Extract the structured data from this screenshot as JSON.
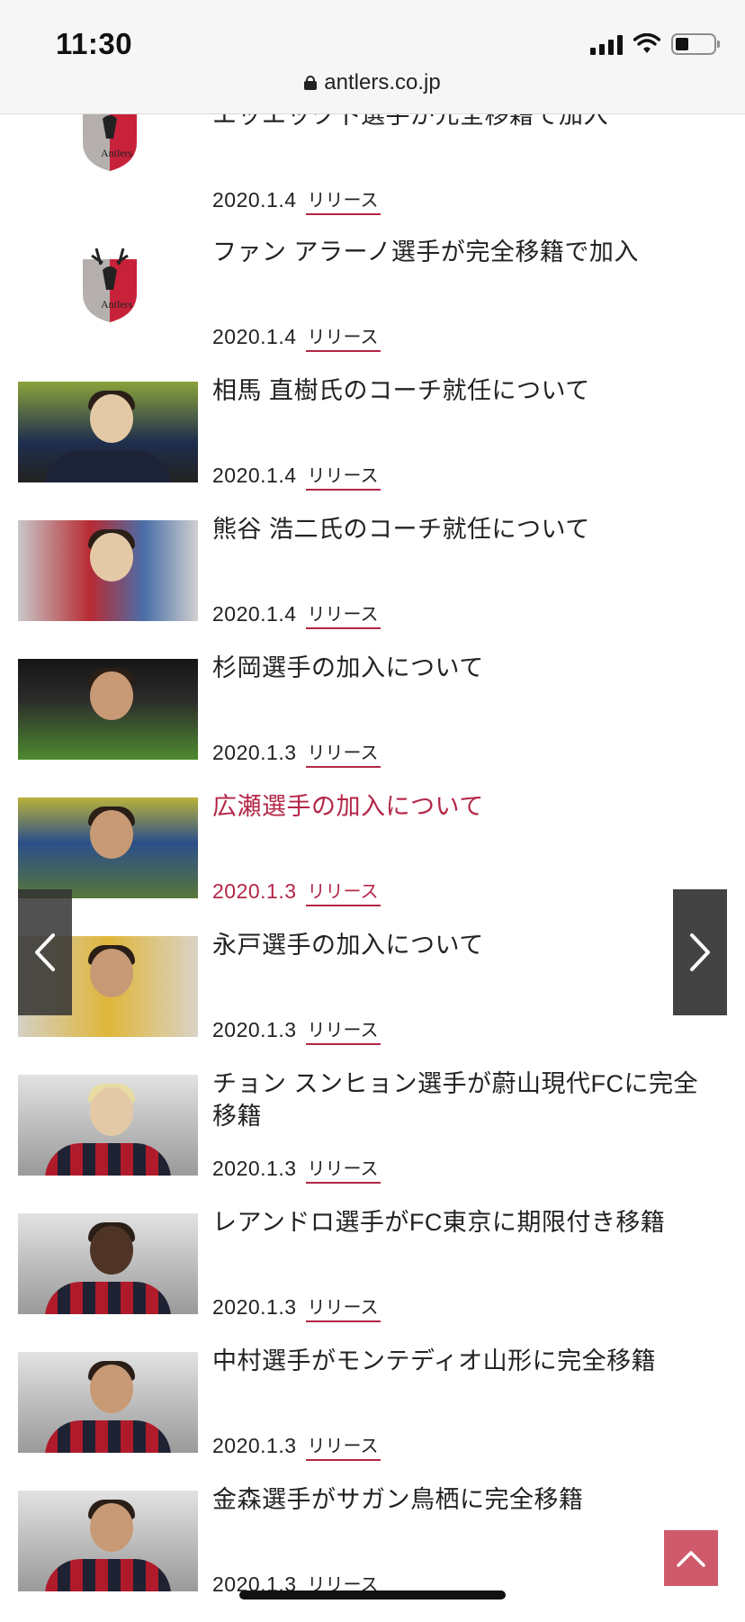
{
  "status_bar": {
    "time": "11:30"
  },
  "browser": {
    "url": "antlers.co.jp"
  },
  "news_items": [
    {
      "title": "エッエック卜選手が元全移籍で加入",
      "date": "2020.1.4",
      "tag": "リリース",
      "thumb": "club-logo"
    },
    {
      "title": "ファン アラーノ選手が完全移籍で加入",
      "date": "2020.1.4",
      "tag": "リリース",
      "thumb": "club-logo"
    },
    {
      "title": "相馬 直樹氏のコーチ就任について",
      "date": "2020.1.4",
      "tag": "リリース",
      "thumb": "photo"
    },
    {
      "title": "熊谷 浩二氏のコーチ就任について",
      "date": "2020.1.4",
      "tag": "リリース",
      "thumb": "photo"
    },
    {
      "title": "杉岡選手の加入について",
      "date": "2020.1.3",
      "tag": "リリース",
      "thumb": "photo"
    },
    {
      "title": "広瀬選手の加入について",
      "date": "2020.1.3",
      "tag": "リリース",
      "thumb": "photo",
      "active": true
    },
    {
      "title": "永戸選手の加入について",
      "date": "2020.1.3",
      "tag": "リリース",
      "thumb": "photo"
    },
    {
      "title": "チョン スンヒョン選手が蔚山現代FCに完全移籍",
      "date": "2020.1.3",
      "tag": "リリース",
      "thumb": "photo"
    },
    {
      "title": "レアンドロ選手がFC東京に期限付き移籍",
      "date": "2020.1.3",
      "tag": "リリース",
      "thumb": "photo"
    },
    {
      "title": "中村選手がモンテディオ山形に完全移籍",
      "date": "2020.1.3",
      "tag": "リリース",
      "thumb": "photo"
    },
    {
      "title": "金森選手がサガン鳥栖に完全移籍",
      "date": "2020.1.3",
      "tag": "リリース",
      "thumb": "photo"
    }
  ],
  "icons": {
    "prev": "chevron-left-icon",
    "next": "chevron-right-icon",
    "top": "chevron-up-icon",
    "lock": "lock-icon"
  },
  "colors": {
    "accent": "#b32647",
    "top_button": "#cf5a6c"
  }
}
